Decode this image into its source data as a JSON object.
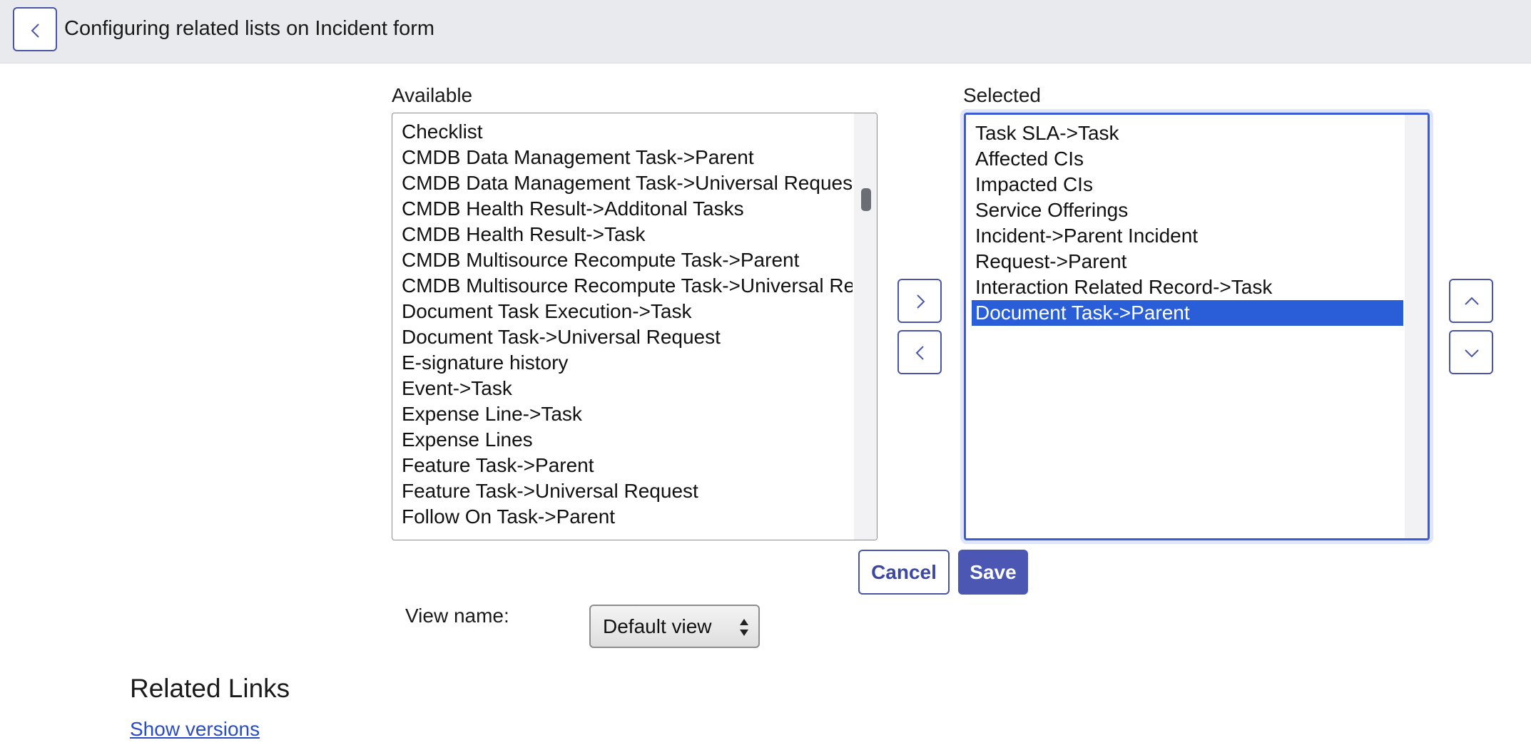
{
  "header": {
    "title": "Configuring related lists on Incident form",
    "back_icon": "chevron-left-icon"
  },
  "available": {
    "label": "Available",
    "items": [
      "Checklist",
      "CMDB Data Management Task->Parent",
      "CMDB Data Management Task->Universal Request",
      "CMDB Health Result->Additonal Tasks",
      "CMDB Health Result->Task",
      "CMDB Multisource Recompute Task->Parent",
      "CMDB Multisource Recompute Task->Universal Rec",
      "Document Task Execution->Task",
      "Document Task->Universal Request",
      "E-signature history",
      "Event->Task",
      "Expense Line->Task",
      "Expense Lines",
      "Feature Task->Parent",
      "Feature Task->Universal Request",
      "Follow On Task->Parent"
    ]
  },
  "selected": {
    "label": "Selected",
    "items": [
      "Task SLA->Task",
      "Affected CIs",
      "Impacted CIs",
      "Service Offerings",
      "Incident->Parent Incident",
      "Request->Parent",
      "Interaction Related Record->Task",
      "Document Task->Parent"
    ],
    "highlighted": "Document Task->Parent"
  },
  "move_buttons": {
    "add_icon": "chevron-right-icon",
    "remove_icon": "chevron-left-icon"
  },
  "order_buttons": {
    "up_icon": "chevron-up-icon",
    "down_icon": "chevron-down-icon"
  },
  "actions": {
    "cancel_label": "Cancel",
    "save_label": "Save"
  },
  "view": {
    "label": "View name:",
    "value": "Default view"
  },
  "related_links": {
    "title": "Related Links",
    "show_versions": "Show versions"
  },
  "colors": {
    "accent": "#4c57b4",
    "selection": "#2a5ed9",
    "header_bg": "#e9eaee",
    "link": "#2a4cc4"
  }
}
